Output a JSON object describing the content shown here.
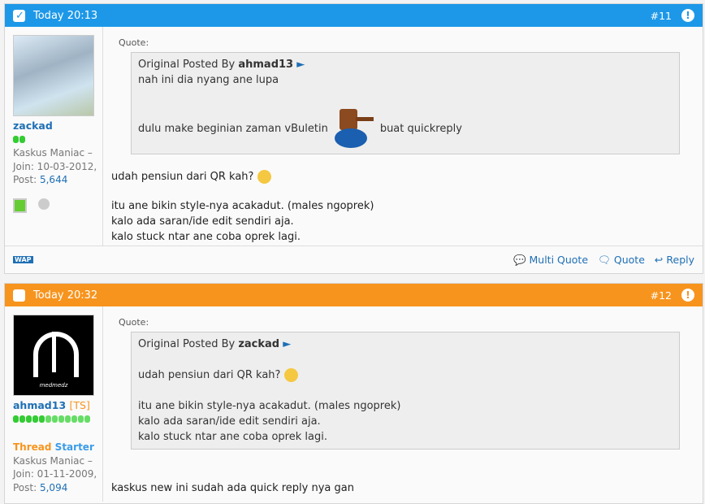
{
  "posts": [
    {
      "time": "Today 20:13",
      "number": "#11",
      "header_color": "#1d98e8",
      "user": {
        "name": "zackad",
        "rank": "Kaskus Maniac –",
        "join": "Join: 10-03-2012,",
        "post_label": "Post:",
        "post_count": "5,644"
      },
      "quote": {
        "label": "Quote:",
        "prefix": "Original Posted By",
        "author": "ahmad13",
        "lines": [
          "nah ini dia nyang ane lupa",
          "dulu make beginian zaman vBuletin",
          "buat quickreply"
        ]
      },
      "body": [
        "udah pensiun dari QR kah?",
        "itu ane bikin style-nya acakadut. (males ngoprek)",
        "kalo ada saran/ide edit sendiri aja.",
        "kalo stuck ntar ane coba oprek lagi."
      ],
      "footer": {
        "wap": "WAP",
        "multi_quote": "Multi Quote",
        "quote": "Quote",
        "reply": "Reply"
      }
    },
    {
      "time": "Today 20:32",
      "number": "#12",
      "header_color": "#f7941d",
      "user": {
        "name": "ahmad13",
        "ts": "[TS]",
        "thread": "Thread",
        "starter": "Starter",
        "rank": "Kaskus Maniac –",
        "join": "Join: 01-11-2009,",
        "post_label": "Post:",
        "post_count": "5,094",
        "avatar_text": "medmedz"
      },
      "quote": {
        "label": "Quote:",
        "prefix": "Original Posted By",
        "author": "zackad",
        "lines": [
          "udah pensiun dari QR kah?",
          "itu ane bikin style-nya acakadut. (males ngoprek)",
          "kalo ada saran/ide edit sendiri aja.",
          "kalo stuck ntar ane coba oprek lagi."
        ]
      },
      "body": [
        "kaskus new ini sudah ada quick reply nya gan"
      ]
    }
  ]
}
